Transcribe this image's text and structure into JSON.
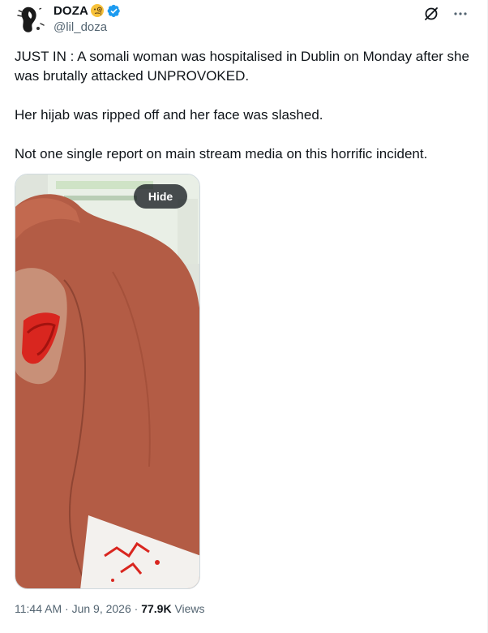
{
  "author": {
    "display_name": "DOZA",
    "emoji_icon": "face-with-monocle-icon",
    "verified_icon": "verified-badge-icon",
    "handle": "@lil_doza",
    "avatar_icon": "profile-avatar"
  },
  "actions": {
    "grok_icon": "grok-icon",
    "more_icon": "more-icon"
  },
  "post": {
    "paragraphs": [
      "JUST IN : A somali woman was hospitalised in Dublin on Monday after she was brutally attacked UNPROVOKED.",
      "Her hijab was ripped off and her face was slashed.",
      "Not one single report on main stream media on this horrific incident."
    ],
    "media_hide_label": "Hide"
  },
  "meta": {
    "time": "11:44 AM",
    "separator": " · ",
    "date": "Jun 9, 2026",
    "views_count": "77.9K",
    "views_label": " Views"
  },
  "colors": {
    "accent_blue": "#1d9bf0",
    "secondary_text": "#536471",
    "primary_text": "#0f1419"
  }
}
